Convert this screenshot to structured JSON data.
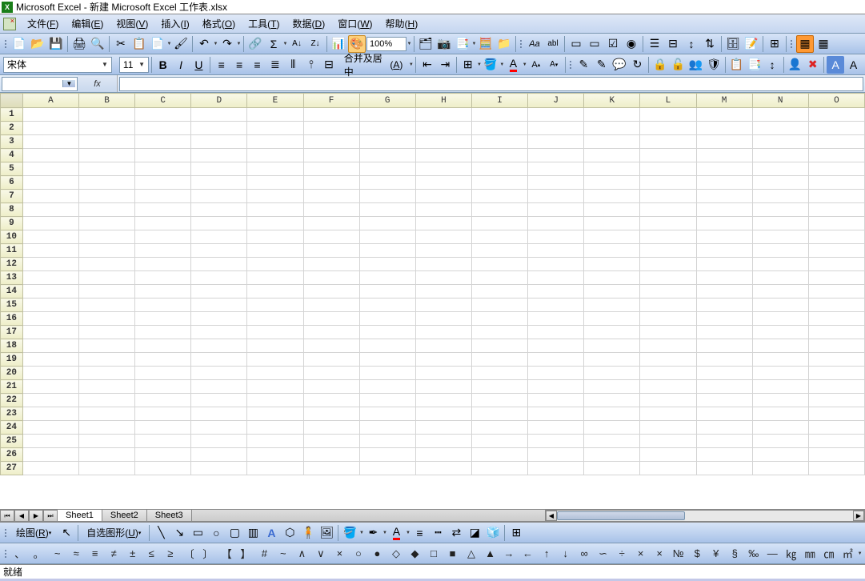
{
  "title": {
    "app": "Microsoft Excel",
    "sep": " - ",
    "doc": "新建 Microsoft Excel 工作表.xlsx"
  },
  "menu": {
    "file": "文件",
    "file_k": "F",
    "edit": "编辑",
    "edit_k": "E",
    "view": "视图",
    "view_k": "V",
    "insert": "插入",
    "insert_k": "I",
    "format": "格式",
    "format_k": "O",
    "tools": "工具",
    "tools_k": "T",
    "data": "数据",
    "data_k": "D",
    "window": "窗口",
    "window_k": "W",
    "help": "帮助",
    "help_k": "H"
  },
  "toolbar1": {
    "zoom": "100%",
    "merge_center": "合并及居中",
    "merge_k": "A"
  },
  "font": {
    "name": "宋体",
    "size": "11"
  },
  "namebox": {
    "fx": "fx"
  },
  "columns": [
    "A",
    "B",
    "C",
    "D",
    "E",
    "F",
    "G",
    "H",
    "I",
    "J",
    "K",
    "L",
    "M",
    "N",
    "O"
  ],
  "rows": [
    "1",
    "2",
    "3",
    "4",
    "5",
    "6",
    "7",
    "8",
    "9",
    "10",
    "11",
    "12",
    "13",
    "14",
    "15",
    "16",
    "17",
    "18",
    "19",
    "20",
    "21",
    "22",
    "23",
    "24",
    "25",
    "26",
    "27"
  ],
  "sheets": {
    "s1": "Sheet1",
    "s2": "Sheet2",
    "s3": "Sheet3"
  },
  "draw": {
    "label": "绘图",
    "label_k": "R",
    "autoshapes": "自选图形",
    "autoshapes_k": "U"
  },
  "symbols": [
    "、",
    "。",
    "~",
    "≈",
    "≡",
    "≠",
    "±",
    "≤",
    "≥",
    "〔",
    "〕",
    "【",
    "】",
    "#",
    "~",
    "∧",
    "∨",
    "×",
    "○",
    "●",
    "◇",
    "◆",
    "□",
    "■",
    "△",
    "▲",
    "→",
    "←",
    "↑",
    "↓",
    "∞",
    "∽",
    "÷",
    "×",
    "×",
    "№",
    "$",
    "¥",
    "§",
    "‰",
    "—",
    "㎏",
    "㎜",
    "㎝",
    "㎡"
  ],
  "status": {
    "ready": "就绪"
  }
}
